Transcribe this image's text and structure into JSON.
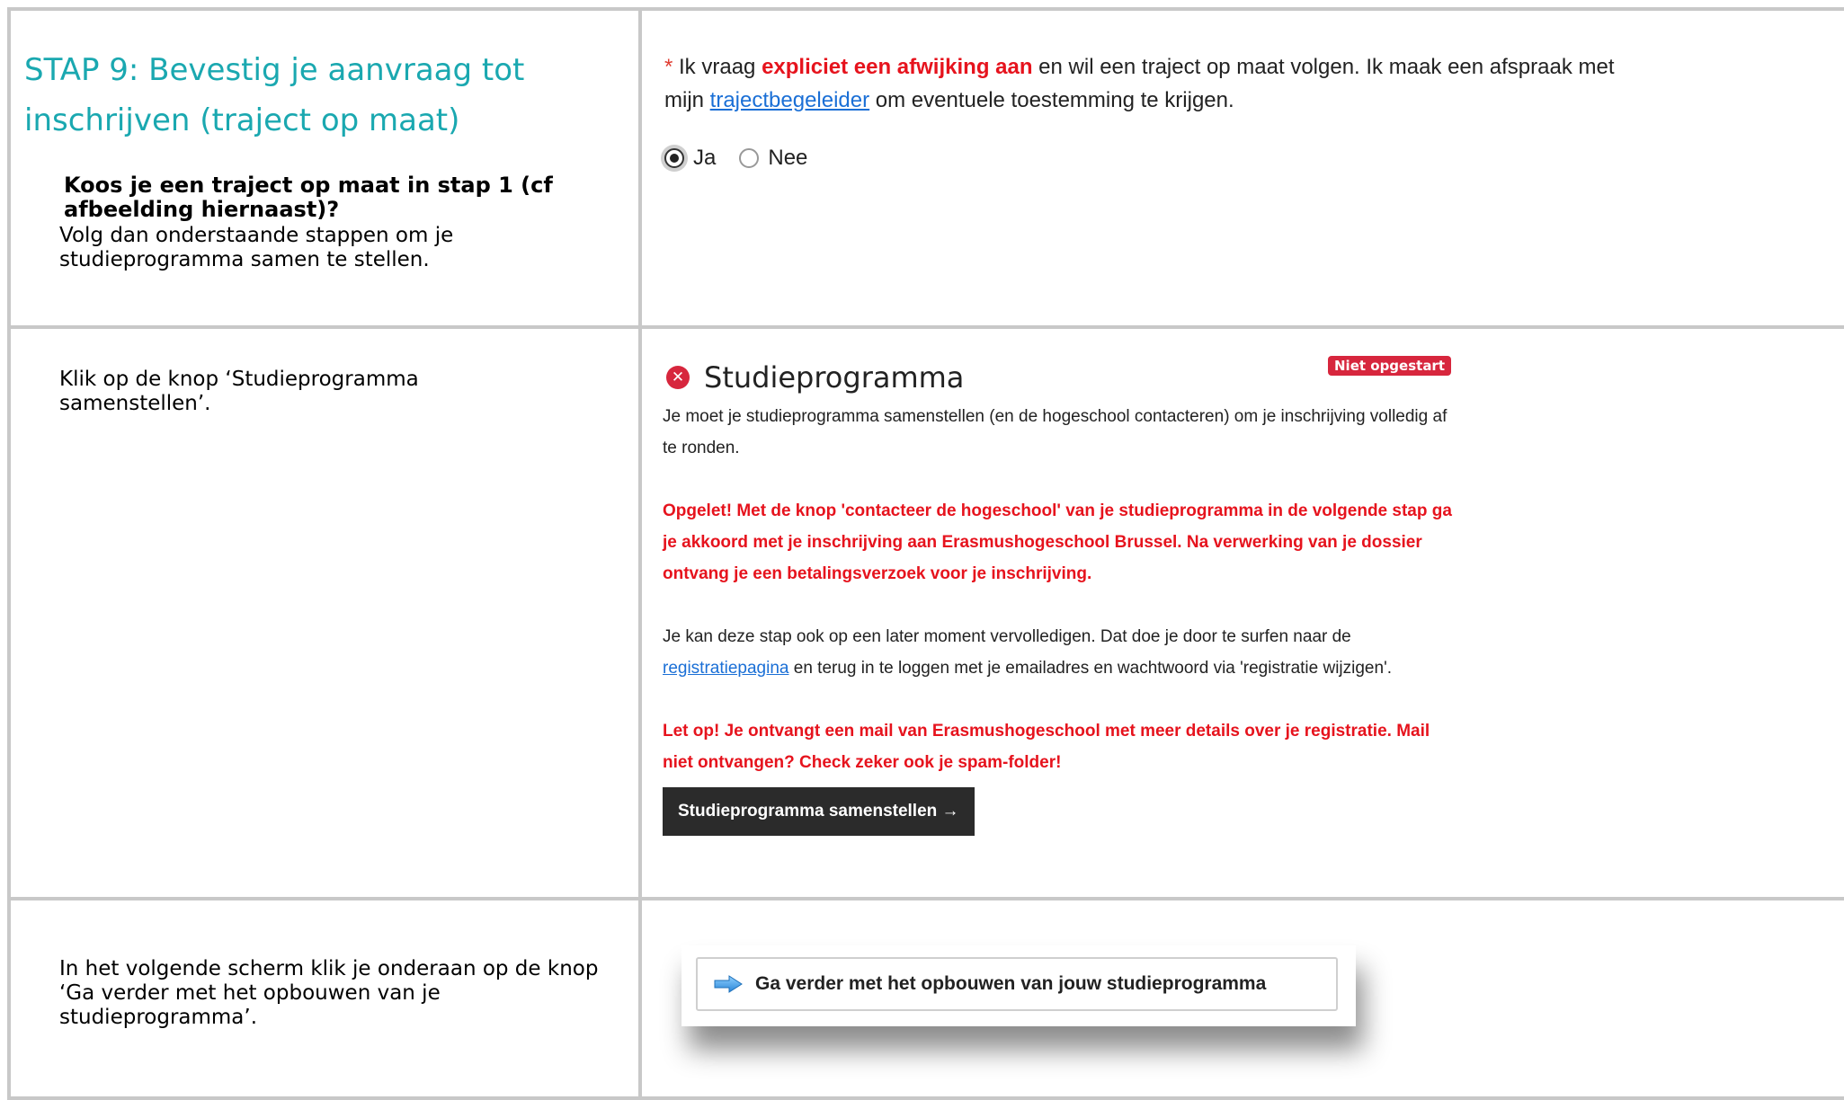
{
  "row1": {
    "title": "STAP 9: Bevestig je aanvraag tot inschrijven (traject op maat)",
    "question": "Koos je een traject op maat in stap 1 (cf afbeelding hiernaast)?",
    "instruction": "Volg dan onderstaande stappen om je studieprogramma samen te stellen.",
    "star": "*",
    "text_before": " Ik vraag ",
    "emphasis": "expliciet een afwijking aan",
    "text_mid": " en wil een traject op maat volgen. Ik maak een afspraak met mijn ",
    "link": "trajectbegeleider",
    "text_after": " om eventuele toestemming te krijgen.",
    "radio_yes": "Ja",
    "radio_no": "Nee"
  },
  "row2": {
    "instruction": "Klik op de knop ‘Studieprogramma samenstellen’.",
    "panel_title": "Studieprogramma",
    "badge": "Niet opgestart",
    "intro": "Je moet je studieprogramma samenstellen (en de hogeschool contacteren) om je inschrijving volledig af te ronden.",
    "warning": "Opgelet! Met de knop 'contacteer de hogeschool' van je studieprogramma in de volgende stap ga je akkoord met je inschrijving aan Erasmushogeschool Brussel. Na verwerking van je dossier ontvang je een  betalingsverzoek voor je inschrijving.",
    "later_before": "Je kan deze stap ook op een later moment vervolledigen. Dat doe je door te surfen naar de ",
    "later_link": "registratiepagina",
    "later_after": " en terug in te loggen met je emailadres en wachtwoord via 'registratie wijzigen'.",
    "notice": "Let op! Je ontvangt een mail van Erasmushogeschool met meer details over je registratie. Mail niet ontvangen? Check zeker ook je spam-folder!",
    "button": "Studieprogramma samenstellen →"
  },
  "row3": {
    "instruction": "In het volgende scherm klik je onderaan op de knop ‘Ga verder met het opbouwen van je studieprogramma’.",
    "button": "Ga verder met het opbouwen van jouw studieprogramma"
  },
  "colors": {
    "title": "#1aa8b0",
    "red": "#e6131d",
    "link": "#1a6fd6",
    "border": "#c8c8c8"
  }
}
